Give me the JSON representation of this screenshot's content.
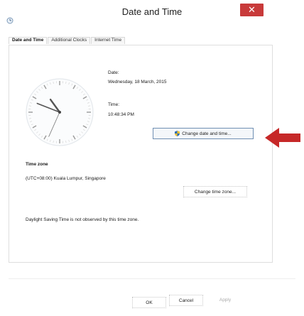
{
  "window": {
    "title": "Date and Time",
    "close_label": "✕"
  },
  "tabs": [
    {
      "label": "Date and Time"
    },
    {
      "label": "Additional Clocks"
    },
    {
      "label": "Internet Time"
    }
  ],
  "clock": {
    "hour": 10,
    "minute": 48,
    "second": 34
  },
  "date": {
    "label": "Date:",
    "value": "Wednesday, 18 March, 2015"
  },
  "time": {
    "label": "Time:",
    "value": "10:48:34 PM"
  },
  "buttons": {
    "change_datetime": "Change date and time...",
    "change_timezone": "Change time zone...",
    "ok": "OK",
    "cancel": "Cancel",
    "apply": "Apply"
  },
  "timezone": {
    "heading": "Time zone",
    "value": "(UTC+08:00) Kuala Lumpur, Singapore"
  },
  "dst_note": "Daylight Saving Time is not observed by this time zone.",
  "colors": {
    "accent": "#2f6fb5",
    "close": "#c83a3a",
    "arrow": "#c62828"
  },
  "icons": {
    "app": "clock-icon",
    "close": "close-icon",
    "shield": "uac-shield-icon",
    "arrow": "pointer-arrow-icon"
  }
}
